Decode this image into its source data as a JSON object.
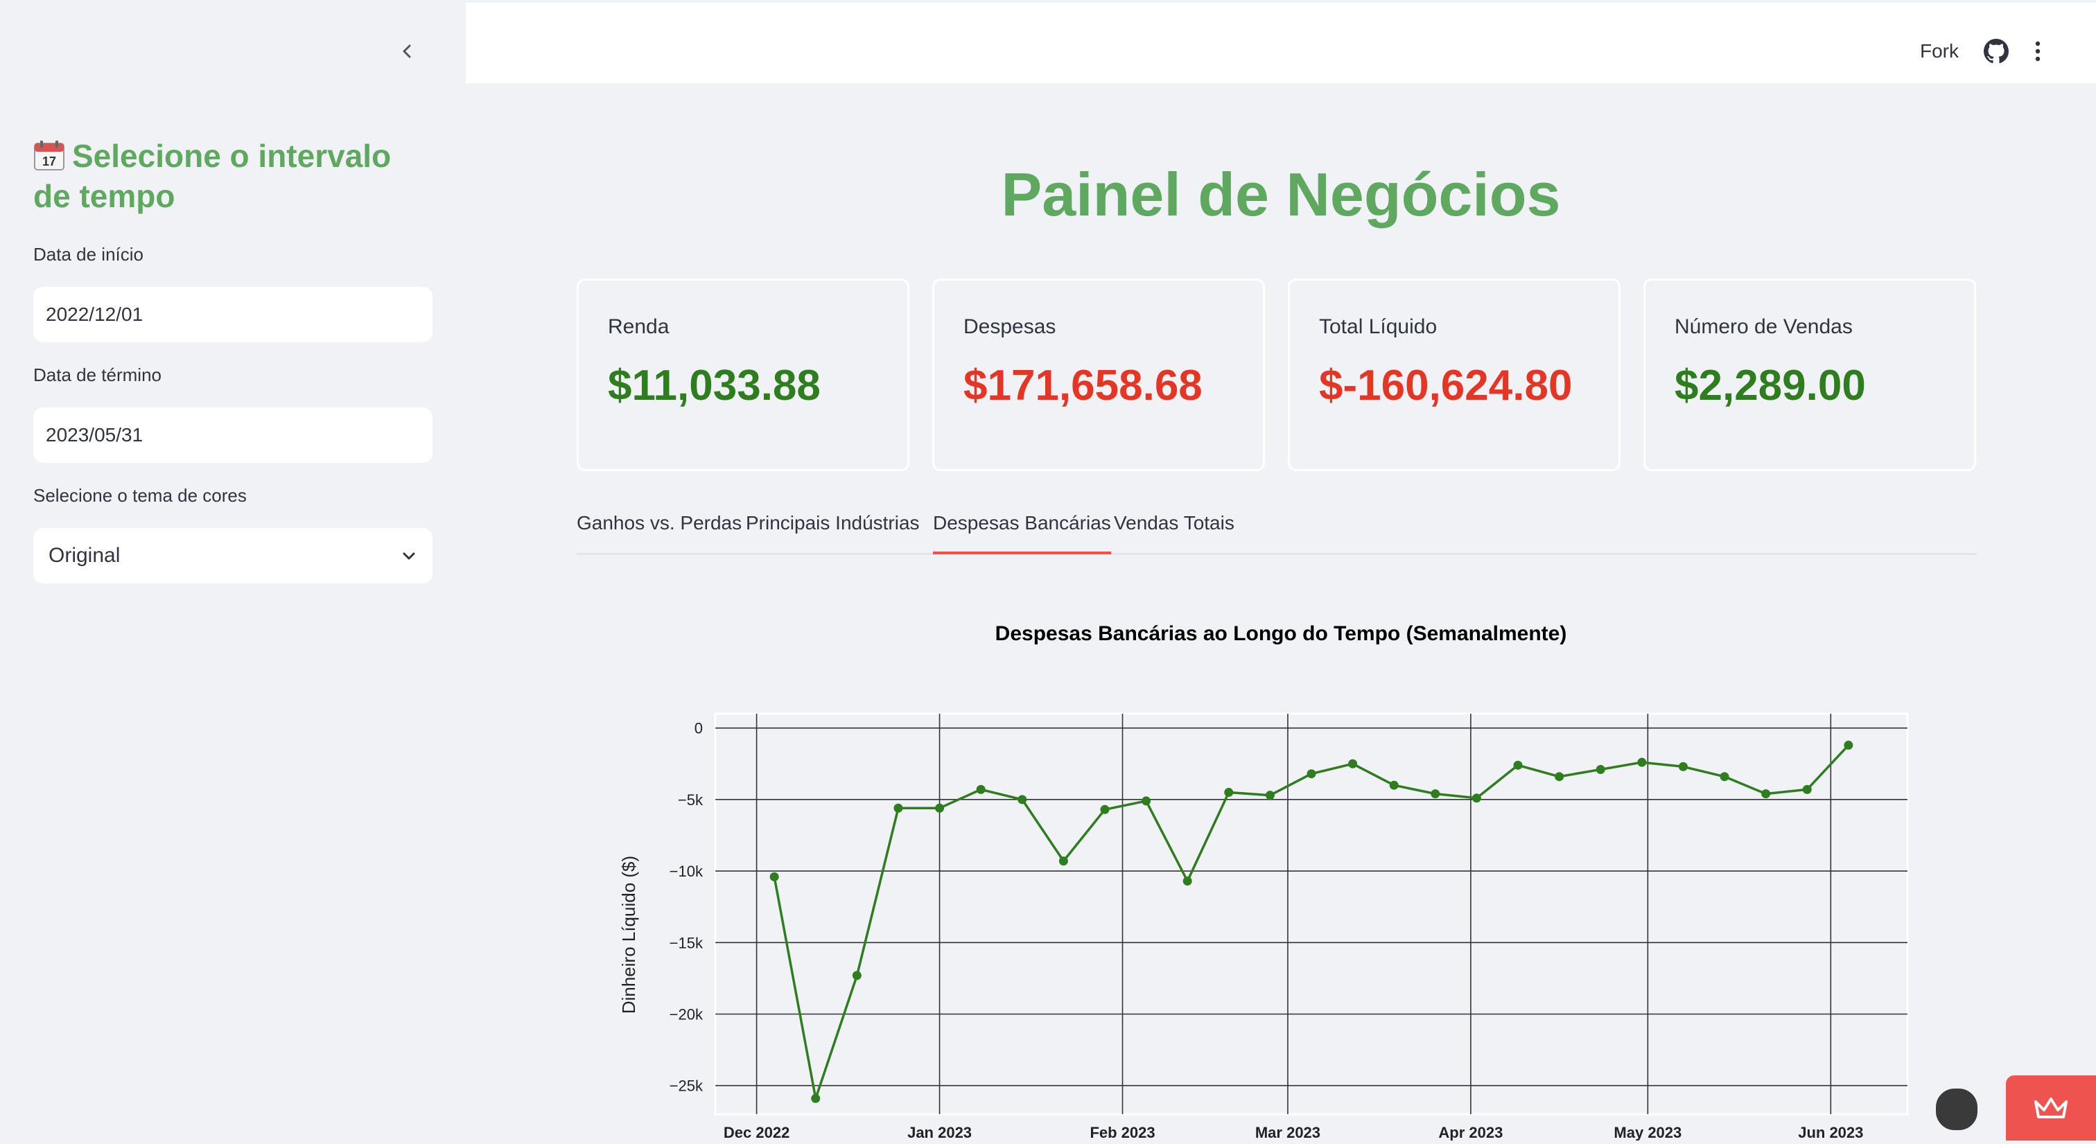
{
  "sidebar": {
    "title": "Selecione o intervalo de tempo",
    "start_label": "Data de início",
    "start_value": "2022/12/01",
    "end_label": "Data de término",
    "end_value": "2023/05/31",
    "theme_label": "Selecione o tema de cores",
    "theme_value": "Original"
  },
  "header": {
    "fork_label": "Fork"
  },
  "page_title": "Painel de Negócios",
  "metrics": [
    {
      "label": "Renda",
      "value": "$11,033.88",
      "color": "#2e7d1e"
    },
    {
      "label": "Despesas",
      "value": "$171,658.68",
      "color": "#e53524"
    },
    {
      "label": "Total Líquido",
      "value": "$-160,624.80",
      "color": "#e53524"
    },
    {
      "label": "Número de Vendas",
      "value": "$2,289.00",
      "color": "#2e7d1e"
    }
  ],
  "tabs": [
    {
      "label": "Ganhos vs. Perdas",
      "active": false
    },
    {
      "label": "Principais Indústrias",
      "active": false
    },
    {
      "label": "Despesas Bancárias",
      "active": true
    },
    {
      "label": "Vendas Totais",
      "active": false
    }
  ],
  "colors": {
    "accent": "#ff4b4b",
    "title_green": "#5fa85f",
    "line": "#2e7d1e"
  },
  "chart_data": {
    "type": "line",
    "title": "Despesas Bancárias ao Longo do Tempo (Semanalmente)",
    "ylabel": "Dinheiro Líquido ($)",
    "xlabel": "",
    "x": [
      "2022-12-04",
      "2022-12-11",
      "2022-12-18",
      "2022-12-25",
      "2023-01-01",
      "2023-01-08",
      "2023-01-15",
      "2023-01-22",
      "2023-01-29",
      "2023-02-05",
      "2023-02-12",
      "2023-02-19",
      "2023-02-26",
      "2023-03-05",
      "2023-03-12",
      "2023-03-19",
      "2023-03-26",
      "2023-04-02",
      "2023-04-09",
      "2023-04-16",
      "2023-04-23",
      "2023-04-30",
      "2023-05-07",
      "2023-05-14",
      "2023-05-21",
      "2023-05-28",
      "2023-06-04"
    ],
    "series": [
      {
        "values": [
          -10400,
          -25900,
          -17300,
          -5600,
          -5600,
          -4300,
          -5000,
          -9300,
          -5700,
          -5100,
          -10700,
          -4500,
          -4700,
          -3200,
          -2500,
          -4000,
          -4600,
          -4900,
          -2600,
          -3400,
          -2900,
          -2400,
          -2700,
          -3400,
          -4600,
          -4300,
          -1200
        ]
      }
    ],
    "yticks": [
      "0",
      "−5k",
      "−10k",
      "−15k",
      "−20k",
      "−25k"
    ],
    "ytick_values": [
      0,
      -5000,
      -10000,
      -15000,
      -20000,
      -25000
    ],
    "ylim": [
      -27000,
      1000
    ],
    "xticks": [
      "Dec 2022",
      "Jan 2023",
      "Feb 2023",
      "Mar 2023",
      "Apr 2023",
      "May 2023",
      "Jun 2023"
    ],
    "xtick_dates": [
      "2022-12-01",
      "2023-01-01",
      "2023-02-01",
      "2023-03-01",
      "2023-04-01",
      "2023-05-01",
      "2023-06-01"
    ],
    "xlim": [
      "2022-11-24",
      "2023-06-14"
    ],
    "grid": true
  }
}
